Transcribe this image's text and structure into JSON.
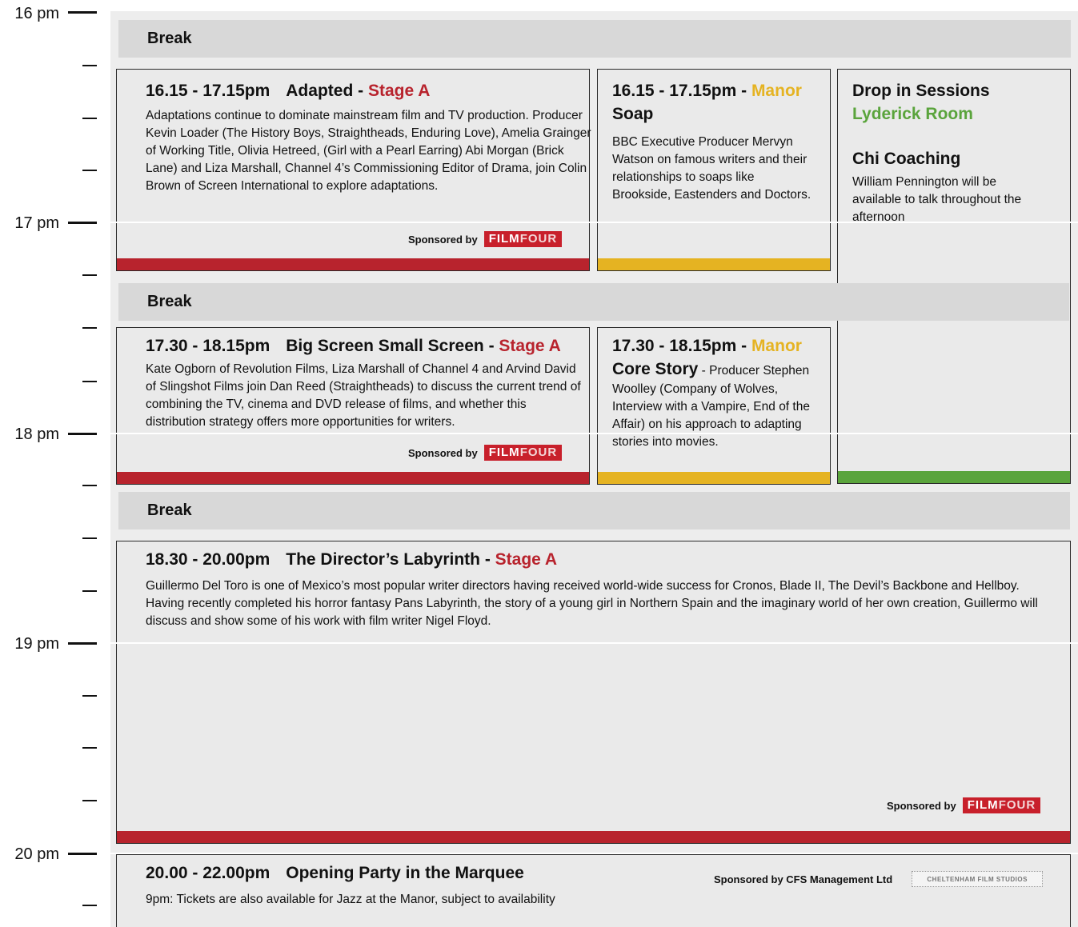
{
  "timeline": {
    "hours": [
      "16 pm",
      "17 pm",
      "18 pm",
      "19 pm",
      "20 pm"
    ]
  },
  "breaks": [
    "Break",
    "Break",
    "Break"
  ],
  "colors": {
    "red": "#b8232d",
    "yellow": "#e5b322",
    "green": "#5aa43c"
  },
  "sessions": [
    {
      "time": "16.15 - 17.15pm",
      "title": "Adapted",
      "sep": "-",
      "venue": "Stage A",
      "desc": "Adaptations continue to dominate mainstream film and TV production. Producer Kevin Loader (The History Boys, Straightheads, Enduring Love), Amelia Grainger of Working Title, Olivia Hetreed, (Girl with a Pearl Earring) Abi Morgan (Brick Lane) and Liza Marshall, Channel 4’s Commissioning Editor of Drama,  join Colin Brown of Screen International to explore adaptations.",
      "sponsored": "Sponsored by"
    },
    {
      "time": "16.15 - 17.15pm -",
      "venue": "Manor",
      "title": "Soap",
      "desc": "BBC Executive Producer Mervyn Watson on famous writers and their relationships to soaps like Brookside, Eastenders and Doctors."
    },
    {
      "title": "Drop in Sessions",
      "venue": "Lyderick Room",
      "subtitle": "Chi Coaching",
      "desc": "William Pennington will be available to talk throughout the afternoon"
    },
    {
      "time": "17.30 - 18.15pm",
      "title": "Big Screen Small Screen",
      "sep": "-",
      "venue": "Stage A",
      "desc": "Kate Ogborn of Revolution Films, Liza Marshall of Channel 4 and Arvind David  of Slingshot Films join Dan Reed (Straightheads)  to discuss the current trend of combining the TV, cinema and DVD release of films, and whether this distribution strategy offers more opportunities for writers.",
      "sponsored": "Sponsored by"
    },
    {
      "time": "17.30 - 18.15pm -",
      "venue": "Manor",
      "title": "Core Story",
      "desc": "- Producer Stephen Woolley (Company of Wolves, Interview with a Vampire, End of the Affair) on his approach to adapting stories into movies."
    },
    {
      "time": "18.30 - 20.00pm",
      "title": "The Director’s Labyrinth",
      "sep": "-",
      "venue": "Stage A",
      "desc": "Guillermo Del Toro is one of Mexico’s most popular writer directors having received world-wide success for Cronos, Blade II, The Devil’s Backbone and Hellboy. Having recently completed his horror fantasy Pans Labyrinth, the story of a young girl in Northern Spain and the imaginary world of her own creation, Guillermo will discuss and show some of his work with film writer Nigel Floyd.",
      "sponsored": "Sponsored by"
    },
    {
      "time": "20.00 - 22.00pm",
      "title": "Opening Party in the Marquee",
      "desc": "9pm: Tickets are also available for Jazz at the Manor, subject to availability",
      "sponsored": "Sponsored by CFS Management Ltd",
      "logo": "CHELTENHAM FILM STUDIOS"
    }
  ],
  "sponsor_logo": {
    "film": "FILM",
    "four": "FOUR"
  }
}
